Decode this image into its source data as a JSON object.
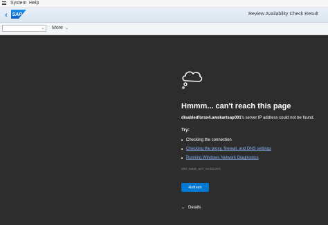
{
  "menubar": {
    "items": [
      {
        "label": "System"
      },
      {
        "label": "Help"
      }
    ]
  },
  "header": {
    "title": "Review Availability Check Result",
    "logo_text": "SAP"
  },
  "toolbar": {
    "command_field": {
      "value": ""
    },
    "more_label": "More"
  },
  "error_page": {
    "heading": "Hmmm... can't reach this page",
    "host": "disabledforsx4.awskartsap001",
    "message_suffix": "'s server IP address could not be found.",
    "try_label": "Try:",
    "suggestions": [
      {
        "text": "Checking the connection",
        "is_link": false
      },
      {
        "text": "Checking the proxy, firewall, and DNS settings",
        "is_link": true
      },
      {
        "text": "Running Windows Network Diagnostics",
        "is_link": true
      }
    ],
    "error_code": "ERR_NAME_NOT_RESOLVED",
    "refresh_label": "Refresh",
    "details_label": "Details"
  },
  "colors": {
    "sap_blue": "#0a6ed1",
    "error_bg": "#2d2d2d",
    "refresh_button": "#0078d4",
    "link": "#8ab4f8"
  }
}
